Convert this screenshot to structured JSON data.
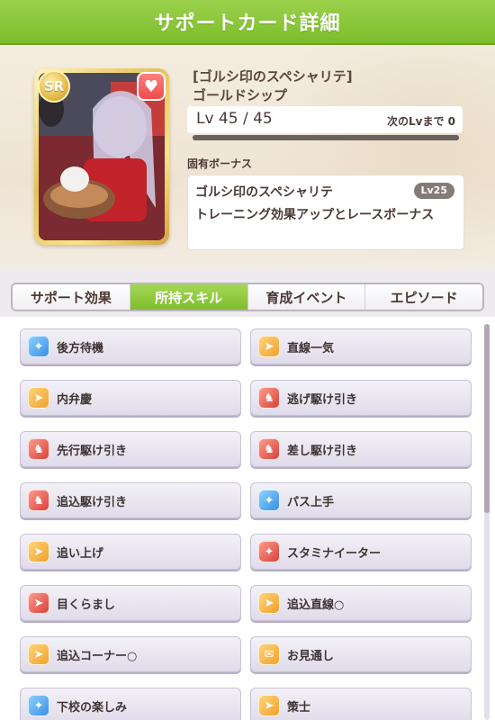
{
  "header": {
    "title": "サポートカード詳細"
  },
  "card": {
    "rarity": "SR",
    "title_line1": "[ゴルシ印のスペシャリテ]",
    "title_line2": "ゴールドシップ",
    "level_text": "Lv 45 / 45",
    "next_level_label": "次のLvまで 0",
    "level_progress": 1.0
  },
  "unique_bonus": {
    "label": "固有ボーナス",
    "name": "ゴルシ印のスペシャリテ",
    "level": "Lv25",
    "description": "トレーニング効果アップとレースボーナス"
  },
  "tabs": [
    {
      "label": "サポート効果",
      "active": false
    },
    {
      "label": "所持スキル",
      "active": true
    },
    {
      "label": "育成イベント",
      "active": false
    },
    {
      "label": "エピソード",
      "active": false
    }
  ],
  "skills": [
    {
      "label": "後方待機",
      "icon": "blue-sparkle-icon"
    },
    {
      "label": "直線一気",
      "icon": "gold-runner-icon"
    },
    {
      "label": "内弁慶",
      "icon": "gold-runner-icon"
    },
    {
      "label": "逃げ駆け引き",
      "icon": "red-horse-icon"
    },
    {
      "label": "先行駆け引き",
      "icon": "red-horse-icon"
    },
    {
      "label": "差し駆け引き",
      "icon": "red-horse-icon"
    },
    {
      "label": "追込駆け引き",
      "icon": "red-horse-icon"
    },
    {
      "label": "パス上手",
      "icon": "blue-sparkle-icon"
    },
    {
      "label": "追い上げ",
      "icon": "gold-runner-icon"
    },
    {
      "label": "スタミナイーター",
      "icon": "red-sparkle-icon"
    },
    {
      "label": "目くらまし",
      "icon": "red-runner-icon"
    },
    {
      "label": "追込直線○",
      "icon": "gold-runner-icon"
    },
    {
      "label": "追込コーナー○",
      "icon": "gold-runner-icon"
    },
    {
      "label": "お見通し",
      "icon": "gold-horn-icon"
    },
    {
      "label": "下校の楽しみ",
      "icon": "blue-sparkle-icon"
    },
    {
      "label": "策士",
      "icon": "gold-runner-icon"
    }
  ]
}
